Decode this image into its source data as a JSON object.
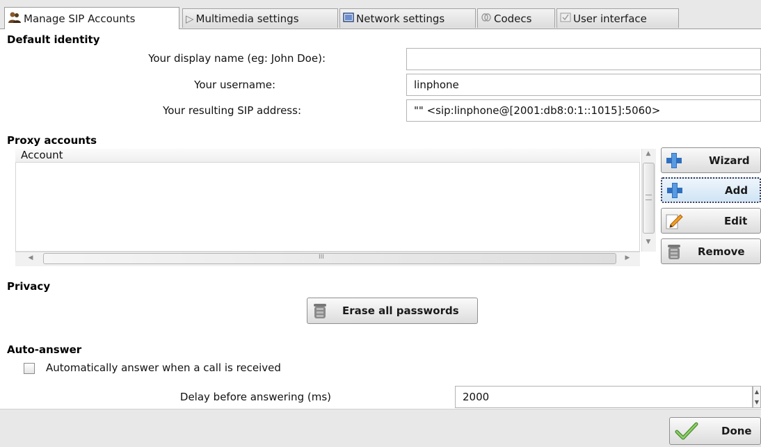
{
  "tabs": [
    {
      "label": "Manage SIP Accounts",
      "icon": "people-icon",
      "active": true
    },
    {
      "label": "Multimedia settings",
      "icon": "play-icon",
      "active": false
    },
    {
      "label": "Network settings",
      "icon": "network-icon",
      "active": false
    },
    {
      "label": "Codecs",
      "icon": "codec-icon",
      "active": false
    },
    {
      "label": "User interface",
      "icon": "ui-icon",
      "active": false
    }
  ],
  "default_identity": {
    "title": "Default identity",
    "display_name_label": "Your display name (eg: John Doe):",
    "display_name_value": "",
    "username_label": "Your username:",
    "username_value": "linphone",
    "sip_address_label": "Your resulting SIP address:",
    "sip_address_value": "\"\" <sip:linphone@[2001:db8:0:1::1015]:5060>"
  },
  "proxy_accounts": {
    "title": "Proxy accounts",
    "column_header": "Account",
    "rows": [],
    "hscroll_grip": "III",
    "buttons": {
      "wizard": "Wizard",
      "add": "Add",
      "edit": "Edit",
      "remove": "Remove"
    }
  },
  "privacy": {
    "title": "Privacy",
    "erase_button": "Erase all passwords"
  },
  "auto_answer": {
    "title": "Auto-answer",
    "checkbox_label": "Automatically answer when a call is received",
    "checked": false,
    "delay_label": "Delay before answering (ms)",
    "delay_value": "2000"
  },
  "footer": {
    "done_button": "Done"
  },
  "colors": {
    "plus_blue": "#2f6fc0",
    "check_green": "#6ab04c",
    "tab_bg": "#e8e8e8"
  }
}
